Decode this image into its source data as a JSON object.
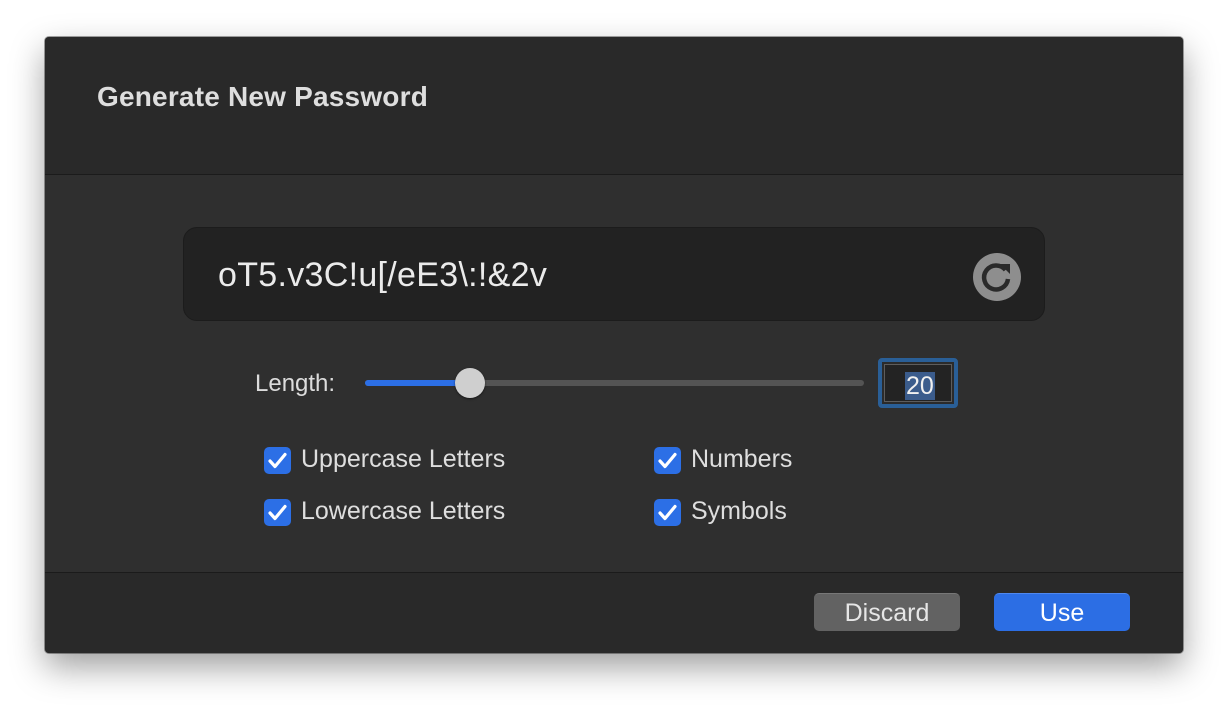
{
  "dialog": {
    "title": "Generate New Password",
    "password": "oT5.v3C!u[/eE3\\:!&2v",
    "refresh_icon": "refresh-icon",
    "length": {
      "label": "Length:",
      "value": "20",
      "slider_fraction": 0.21
    },
    "options": [
      {
        "label": "Uppercase Letters",
        "checked": true
      },
      {
        "label": "Numbers",
        "checked": true
      },
      {
        "label": "Lowercase Letters",
        "checked": true
      },
      {
        "label": "Symbols",
        "checked": true
      }
    ],
    "buttons": {
      "discard": "Discard",
      "use": "Use"
    },
    "colors": {
      "accent": "#2c6fe6",
      "background": "#2f2f2f",
      "header": "#292929"
    }
  }
}
